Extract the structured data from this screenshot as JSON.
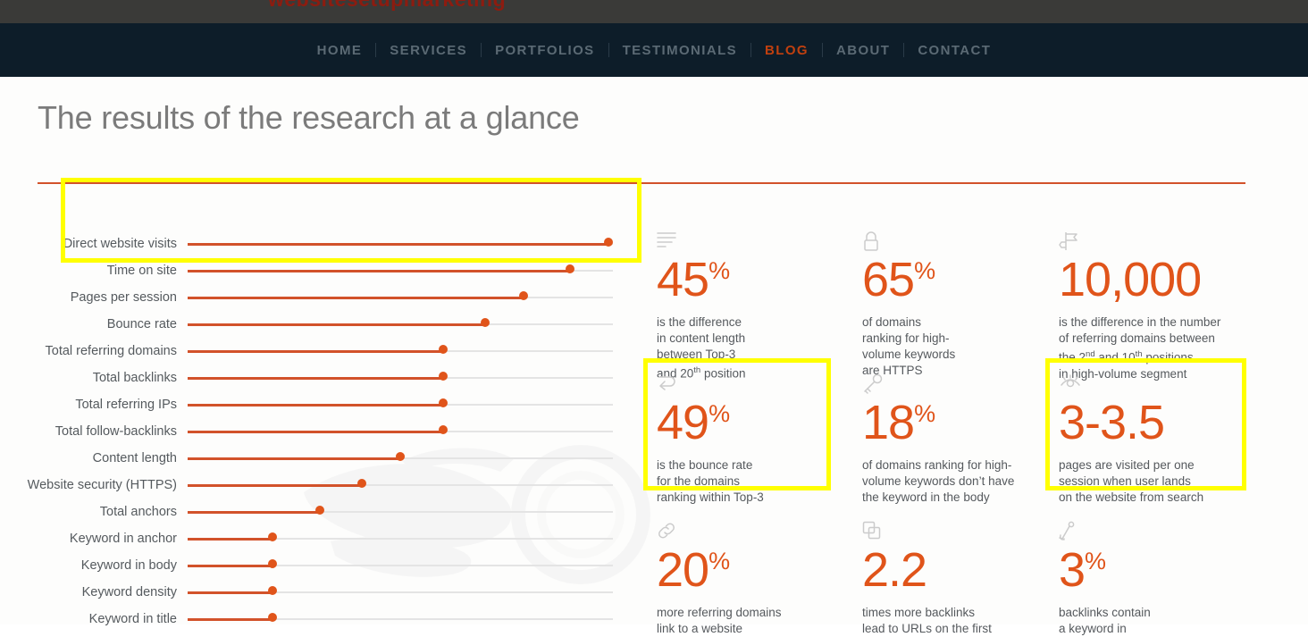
{
  "site": {
    "logo_text": "websitesetupmarketing",
    "brand_color": "#e0541a",
    "highlight_color": "#ffff00",
    "nav_bar_color": "#0d1d29"
  },
  "nav": {
    "items": [
      {
        "label": "HOME",
        "active": false
      },
      {
        "label": "SERVICES",
        "active": false
      },
      {
        "label": "PORTFOLIOS",
        "active": false
      },
      {
        "label": "TESTIMONIALS",
        "active": false
      },
      {
        "label": "BLOG",
        "active": true
      },
      {
        "label": "ABOUT",
        "active": false
      },
      {
        "label": "CONTACT",
        "active": false
      }
    ]
  },
  "header": {
    "title": "The results of the research at a glance"
  },
  "chart_data": {
    "type": "bar",
    "title": "The results of the research at a glance",
    "xlabel": "",
    "ylabel": "",
    "grid": false,
    "legend": "none",
    "xlim": [
      0,
      100
    ],
    "note": "Horizontal lollipop chart; values are relative importance percentages read off bar lengths",
    "categories": [
      "Direct website visits",
      "Time on site",
      "Pages per session",
      "Bounce rate",
      "Total referring domains",
      "Total backlinks",
      "Total referring IPs",
      "Total follow-backlinks",
      "Content length",
      "Website security (HTTPS)",
      "Total anchors",
      "Keyword in anchor",
      "Keyword in body",
      "Keyword density",
      "Keyword in title"
    ],
    "values": [
      99,
      90,
      79,
      70,
      60,
      60,
      60,
      60,
      50,
      41,
      31,
      20,
      20,
      20,
      20
    ],
    "highlighted_categories": [
      "Time on site",
      "Pages per session",
      "Bounce rate"
    ]
  },
  "cards": [
    {
      "icon": "content-lines-icon",
      "number": "45",
      "suffix": "%",
      "desc_lines": [
        "is the difference",
        "in content length",
        "between Top-3",
        "and 20th position"
      ],
      "highlighted": false
    },
    {
      "icon": "lock-icon",
      "number": "65",
      "suffix": "%",
      "desc_lines": [
        "of domains",
        "ranking for high-",
        "volume keywords",
        "are HTTPS"
      ],
      "highlighted": false
    },
    {
      "icon": "signpost-icon",
      "number": "10,000",
      "suffix": "",
      "desc_lines": [
        "is the difference in the number",
        "of referring domains between",
        "the 2nd and 10th positions",
        "in high-volume segment"
      ],
      "highlighted": false
    },
    {
      "icon": "bounce-arrow-icon",
      "number": "49",
      "suffix": "%",
      "desc_lines": [
        "is the bounce rate",
        "for the domains",
        "ranking within Top-3"
      ],
      "highlighted": true
    },
    {
      "icon": "key-icon",
      "number": "18",
      "suffix": "%",
      "desc_lines": [
        "of domains ranking for high-",
        "volume keywords don’t have",
        "the keyword in the body"
      ],
      "highlighted": false
    },
    {
      "icon": "eye-icon",
      "number": "3-3.5",
      "suffix": "",
      "desc_lines": [
        "pages are visited per one",
        "session when user lands",
        "on the website from search"
      ],
      "highlighted": true
    },
    {
      "icon": "link-icon",
      "number": "20",
      "suffix": "%",
      "desc_lines": [
        "more referring domains",
        "link to a website"
      ],
      "highlighted": false
    },
    {
      "icon": "layers-icon",
      "number": "2.2",
      "suffix": "",
      "desc_lines": [
        "times more backlinks",
        "lead to URLs on the first"
      ],
      "highlighted": false
    },
    {
      "icon": "anchor-icon",
      "number": "3",
      "suffix": "%",
      "desc_lines": [
        "backlinks contain",
        "a keyword in"
      ],
      "highlighted": false
    }
  ]
}
